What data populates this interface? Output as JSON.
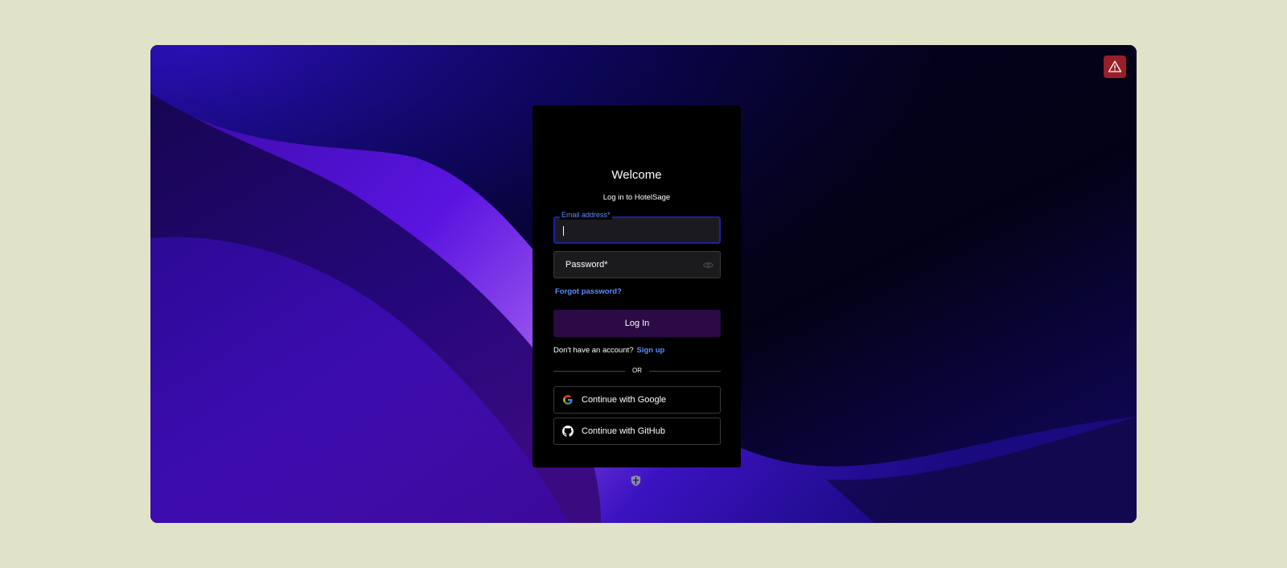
{
  "login": {
    "title": "Welcome",
    "subtitle": "Log in to HotelSage",
    "email_label": "Email address*",
    "email_value": "",
    "password_placeholder": "Password*",
    "forgot_password": "Forgot password?",
    "login_button": "Log In",
    "no_account_text": "Don't have an account?",
    "signup_link": "Sign up",
    "divider_text": "OR",
    "google_button": "Continue with Google",
    "github_button": "Continue with GitHub"
  },
  "icons": {
    "alert": "warning-triangle-icon",
    "password_toggle": "eye-icon",
    "google": "google-icon",
    "github": "github-icon",
    "footer": "shield-icon"
  },
  "colors": {
    "page_background": "#e1e3c8",
    "card_background": "#000000",
    "accent_link": "#5b8dff",
    "login_button": "#2b0a45",
    "alert_button": "#9a1e27",
    "email_focus_border": "#1f1fa6"
  }
}
